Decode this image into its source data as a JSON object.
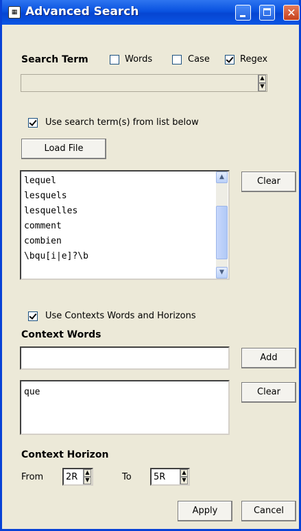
{
  "window": {
    "title": "Advanced Search"
  },
  "search_term": {
    "label": "Search Term",
    "words": {
      "label": "Words",
      "checked": false
    },
    "case": {
      "label": "Case",
      "checked": false
    },
    "regex": {
      "label": "Regex",
      "checked": true
    },
    "input_value": ""
  },
  "terms_list": {
    "use_label": "Use search term(s) from list below",
    "use_checked": true,
    "load_button": "Load File",
    "items": [
      "lequel",
      "lesquels",
      "lesquelles",
      "comment",
      "combien",
      "\\bqu[i|e]?\\b"
    ],
    "clear_button": "Clear"
  },
  "contexts": {
    "use_label": "Use Contexts Words and Horizons",
    "use_checked": true,
    "words_heading": "Context Words",
    "word_input_value": "",
    "add_button": "Add",
    "items": [
      "que"
    ],
    "clear_button": "Clear",
    "horizon_heading": "Context Horizon",
    "from_label": "From",
    "from_value": "2R",
    "to_label": "To",
    "to_value": "5R"
  },
  "actions": {
    "apply": "Apply",
    "cancel": "Cancel"
  },
  "colors": {
    "titlebar": "#0a53e0",
    "close": "#c6421e",
    "window_bg": "#ece9d8"
  }
}
